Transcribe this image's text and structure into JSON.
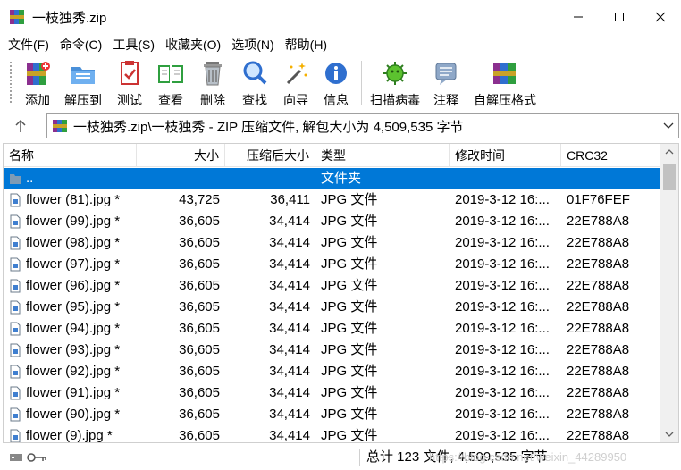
{
  "window": {
    "title": "一枝独秀.zip"
  },
  "menu": [
    "文件(F)",
    "命令(C)",
    "工具(S)",
    "收藏夹(O)",
    "选项(N)",
    "帮助(H)"
  ],
  "toolbar": [
    {
      "label": "添加",
      "icon": "add-icon"
    },
    {
      "label": "解压到",
      "icon": "extract-to-icon"
    },
    {
      "label": "测试",
      "icon": "test-icon"
    },
    {
      "label": "查看",
      "icon": "view-icon"
    },
    {
      "label": "删除",
      "icon": "delete-icon"
    },
    {
      "label": "查找",
      "icon": "find-icon"
    },
    {
      "label": "向导",
      "icon": "wizard-icon"
    },
    {
      "label": "信息",
      "icon": "info-icon"
    },
    {
      "label": "扫描病毒",
      "icon": "virus-scan-icon"
    },
    {
      "label": "注释",
      "icon": "comment-icon"
    },
    {
      "label": "自解压格式",
      "icon": "sfx-icon"
    }
  ],
  "address": {
    "text": "一枝独秀.zip\\一枝独秀 - ZIP 压缩文件, 解包大小为 4,509,535 字节"
  },
  "columns": {
    "name": "名称",
    "size": "大小",
    "packed": "压缩后大小",
    "type": "类型",
    "modified": "修改时间",
    "crc": "CRC32"
  },
  "rows": [
    {
      "name": "..",
      "size": "",
      "packed": "",
      "type": "文件夹",
      "modified": "",
      "crc": "",
      "selected": true,
      "kind": "folder"
    },
    {
      "name": "flower (81).jpg *",
      "size": "43,725",
      "packed": "36,411",
      "type": "JPG 文件",
      "modified": "2019-3-12 16:...",
      "crc": "01F76FEF",
      "kind": "file"
    },
    {
      "name": "flower (99).jpg *",
      "size": "36,605",
      "packed": "34,414",
      "type": "JPG 文件",
      "modified": "2019-3-12 16:...",
      "crc": "22E788A8",
      "kind": "file"
    },
    {
      "name": "flower (98).jpg *",
      "size": "36,605",
      "packed": "34,414",
      "type": "JPG 文件",
      "modified": "2019-3-12 16:...",
      "crc": "22E788A8",
      "kind": "file"
    },
    {
      "name": "flower (97).jpg *",
      "size": "36,605",
      "packed": "34,414",
      "type": "JPG 文件",
      "modified": "2019-3-12 16:...",
      "crc": "22E788A8",
      "kind": "file"
    },
    {
      "name": "flower (96).jpg *",
      "size": "36,605",
      "packed": "34,414",
      "type": "JPG 文件",
      "modified": "2019-3-12 16:...",
      "crc": "22E788A8",
      "kind": "file"
    },
    {
      "name": "flower (95).jpg *",
      "size": "36,605",
      "packed": "34,414",
      "type": "JPG 文件",
      "modified": "2019-3-12 16:...",
      "crc": "22E788A8",
      "kind": "file"
    },
    {
      "name": "flower (94).jpg *",
      "size": "36,605",
      "packed": "34,414",
      "type": "JPG 文件",
      "modified": "2019-3-12 16:...",
      "crc": "22E788A8",
      "kind": "file"
    },
    {
      "name": "flower (93).jpg *",
      "size": "36,605",
      "packed": "34,414",
      "type": "JPG 文件",
      "modified": "2019-3-12 16:...",
      "crc": "22E788A8",
      "kind": "file"
    },
    {
      "name": "flower (92).jpg *",
      "size": "36,605",
      "packed": "34,414",
      "type": "JPG 文件",
      "modified": "2019-3-12 16:...",
      "crc": "22E788A8",
      "kind": "file"
    },
    {
      "name": "flower (91).jpg *",
      "size": "36,605",
      "packed": "34,414",
      "type": "JPG 文件",
      "modified": "2019-3-12 16:...",
      "crc": "22E788A8",
      "kind": "file"
    },
    {
      "name": "flower (90).jpg *",
      "size": "36,605",
      "packed": "34,414",
      "type": "JPG 文件",
      "modified": "2019-3-12 16:...",
      "crc": "22E788A8",
      "kind": "file"
    },
    {
      "name": "flower (9).jpg *",
      "size": "36,605",
      "packed": "34,414",
      "type": "JPG 文件",
      "modified": "2019-3-12 16:...",
      "crc": "22E788A8",
      "kind": "file"
    }
  ],
  "status": {
    "text": "总计 123 文件, 4,509,535 字节",
    "watermark": "https://blog.csdn.net/weixin_44289950"
  },
  "colors": {
    "selection": "#0078d7"
  }
}
